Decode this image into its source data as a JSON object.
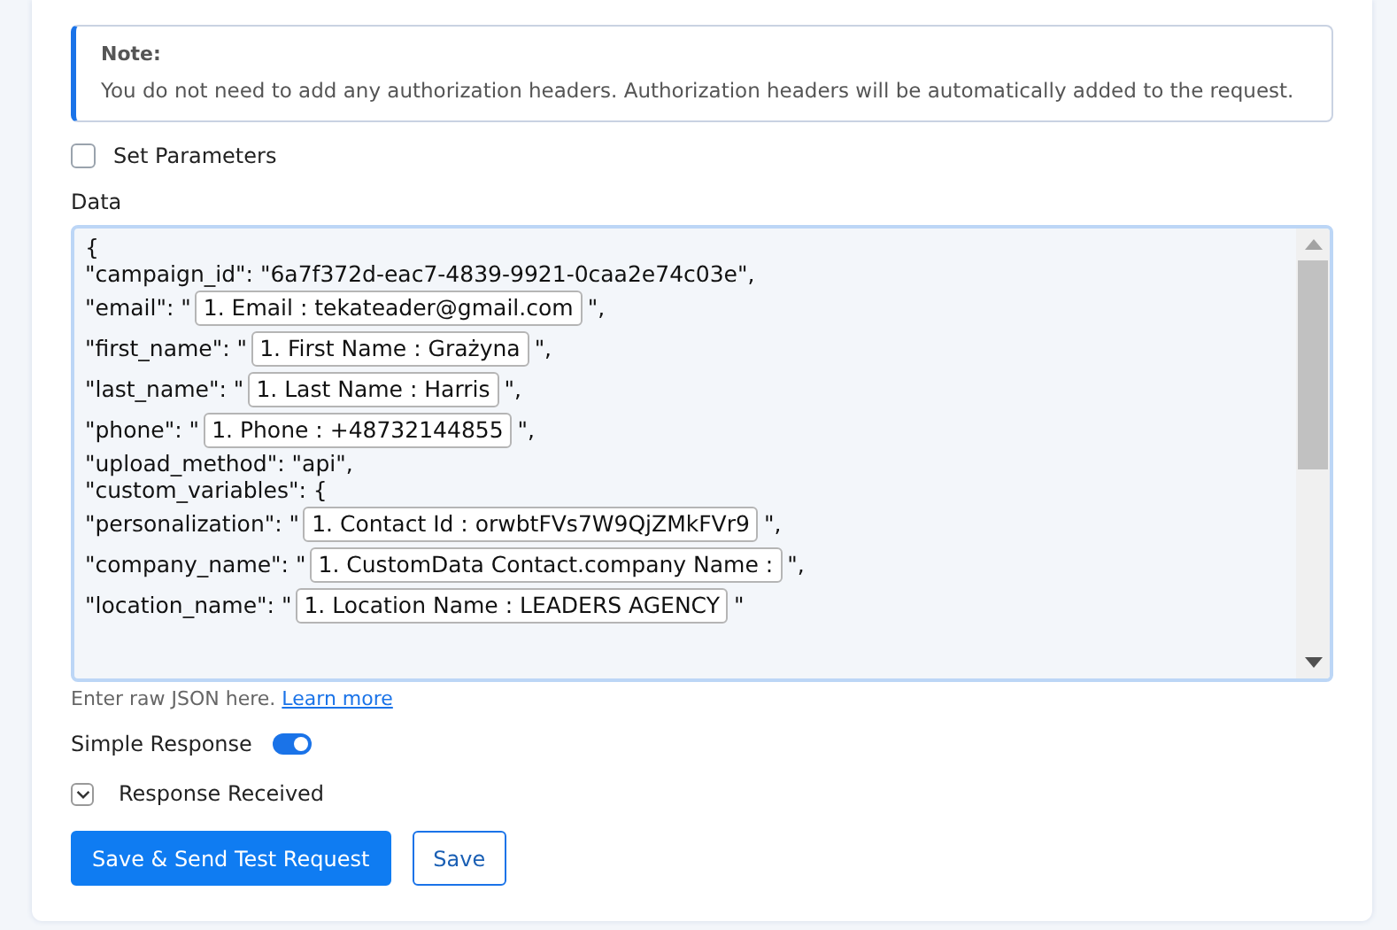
{
  "note": {
    "title": "Note:",
    "text": "You do not need to add any authorization headers. Authorization headers will be automatically added to the request."
  },
  "set_parameters": {
    "label": "Set Parameters",
    "checked": false
  },
  "data": {
    "label": "Data",
    "lines": [
      {
        "kind": "text",
        "text": "{"
      },
      {
        "kind": "text",
        "text": "\"campaign_id\": \"6a7f372d-eac7-4839-9921-0caa2e74c03e\","
      },
      {
        "kind": "token",
        "before": "\"email\": \"",
        "token": "1. Email : tekateader@gmail.com",
        "after": "\","
      },
      {
        "kind": "token",
        "before": "\"first_name\": \"",
        "token": "1. First Name : Grażyna",
        "after": "\","
      },
      {
        "kind": "token",
        "before": "\"last_name\": \"",
        "token": "1. Last Name : Harris",
        "after": "\","
      },
      {
        "kind": "token",
        "before": "\"phone\": \"",
        "token": "1. Phone : +48732144855",
        "after": "\","
      },
      {
        "kind": "text",
        "text": "\"upload_method\": \"api\","
      },
      {
        "kind": "text",
        "text": "\"custom_variables\": {"
      },
      {
        "kind": "token",
        "before": "\"personalization\": \"",
        "token": "1. Contact Id : orwbtFVs7W9QjZMkFVr9",
        "after": "\","
      },
      {
        "kind": "token",
        "before": "\"company_name\": \"",
        "token": "1. CustomData Contact.company Name :",
        "after": "\","
      },
      {
        "kind": "token",
        "before": "\"location_name\": \"",
        "token": "1. Location Name : LEADERS AGENCY",
        "after": "\""
      }
    ],
    "hint": "Enter raw JSON here.",
    "hint_link": "Learn more"
  },
  "simple_response": {
    "label": "Simple Response",
    "on": true
  },
  "response_received": {
    "label": "Response Received",
    "expanded": false
  },
  "buttons": [
    {
      "kind": "primary",
      "label": "Save & Send Test Request"
    },
    {
      "kind": "secondary",
      "label": "Save"
    }
  ]
}
